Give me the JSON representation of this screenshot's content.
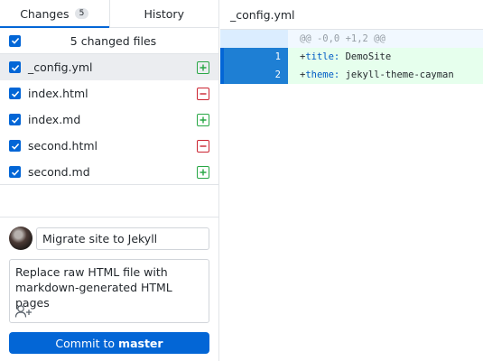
{
  "tabs": {
    "changes_label": "Changes",
    "changes_count": "5",
    "history_label": "History"
  },
  "changes": {
    "summary_label": "5 changed files",
    "files": [
      {
        "name": "_config.yml",
        "status": "added"
      },
      {
        "name": "index.html",
        "status": "deleted"
      },
      {
        "name": "index.md",
        "status": "added"
      },
      {
        "name": "second.html",
        "status": "deleted"
      },
      {
        "name": "second.md",
        "status": "added"
      }
    ]
  },
  "commit": {
    "summary_value": "Migrate site to Jekyll",
    "description_line1": "Replace raw HTML file with",
    "description_line2": "markdown-generated HTML pages",
    "button_prefix": "Commit to",
    "branch": "master"
  },
  "diff": {
    "file_name": "_config.yml",
    "hunk_header": "@@ -0,0 +1,2 @@",
    "lines": [
      {
        "number": "1",
        "sign": "+",
        "key": "title:",
        "value": " DemoSite"
      },
      {
        "number": "2",
        "sign": "+",
        "key": "theme:",
        "value": " jekyll-theme-cayman"
      }
    ]
  },
  "colors": {
    "accent": "#0366d6",
    "added": "#28a745",
    "deleted": "#cb2431"
  }
}
